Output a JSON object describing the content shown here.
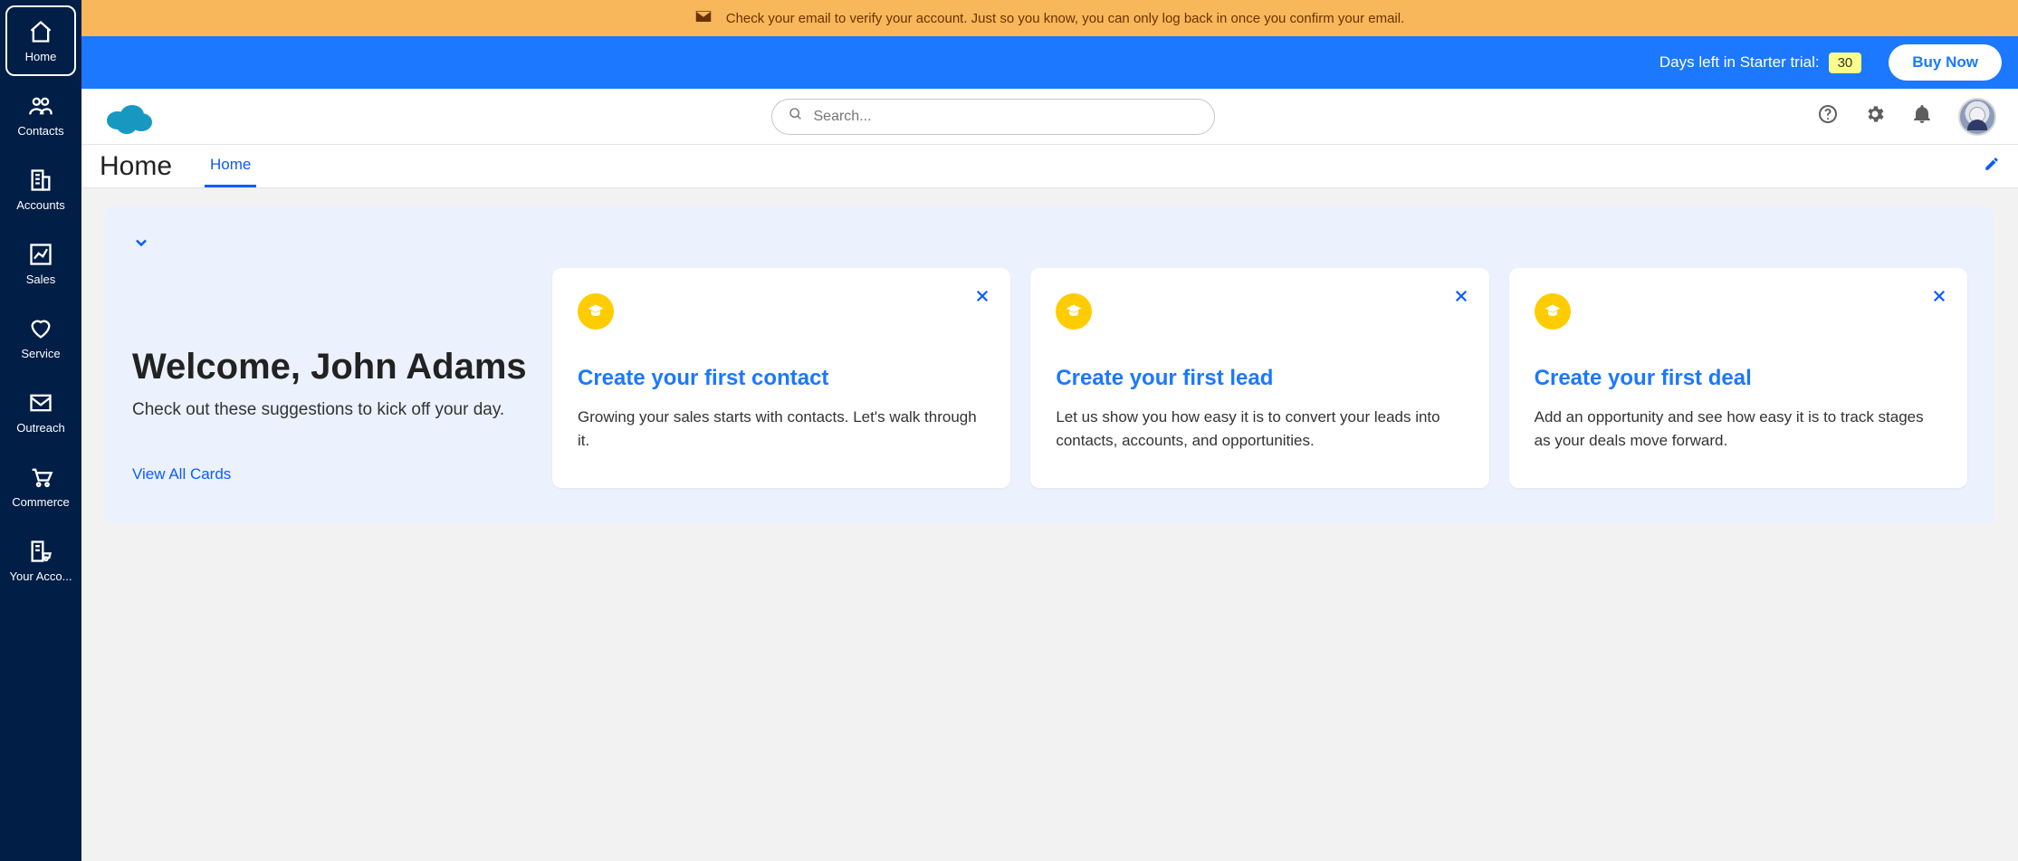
{
  "notification": {
    "text": "Check your email to verify your account. Just so you know, you can only log back in once you confirm your email."
  },
  "trial": {
    "label": "Days left in Starter trial:",
    "days": "30",
    "buy_label": "Buy Now"
  },
  "search": {
    "placeholder": "Search..."
  },
  "page": {
    "title": "Home",
    "tab": "Home"
  },
  "sidebar": {
    "items": [
      {
        "label": "Home"
      },
      {
        "label": "Contacts"
      },
      {
        "label": "Accounts"
      },
      {
        "label": "Sales"
      },
      {
        "label": "Service"
      },
      {
        "label": "Outreach"
      },
      {
        "label": "Commerce"
      },
      {
        "label": "Your Acco..."
      }
    ]
  },
  "welcome": {
    "title": "Welcome, John Adams",
    "subtitle": "Check out these suggestions to kick off your day.",
    "view_all": "View All Cards"
  },
  "cards": [
    {
      "title": "Create your first contact",
      "body": "Growing your sales starts with contacts. Let's walk through it."
    },
    {
      "title": "Create your first lead",
      "body": "Let us show you how easy it is to convert your leads into contacts, accounts, and opportunities."
    },
    {
      "title": "Create your first deal",
      "body": "Add an opportunity and see how easy it is to track stages as your deals move forward."
    }
  ]
}
